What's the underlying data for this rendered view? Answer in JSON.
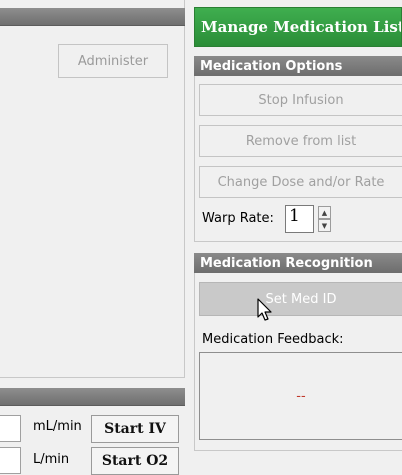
{
  "left": {
    "administer_label": "Administer",
    "iv_unit": "mL/min",
    "iv_button": "Start IV",
    "o2_unit": "L/min",
    "o2_button": "Start O2"
  },
  "manage": {
    "label": "Manage Medication List"
  },
  "medication_options": {
    "header": "Medication Options",
    "stop_infusion": "Stop Infusion",
    "remove_from_list": "Remove from list",
    "change_dose": "Change Dose and/or Rate",
    "warp_rate_label": "Warp Rate:",
    "warp_rate_value": "1"
  },
  "medication_recognition": {
    "header": "Medication Recognition",
    "set_med_id": "Set Med ID",
    "feedback_label": "Medication Feedback:",
    "feedback_value": "--"
  },
  "colors": {
    "manage_green": "#2f9a3e",
    "header_gray": "#7c7c7c",
    "feedback_red": "#c0392b"
  },
  "icons": [
    "spin-up-icon",
    "spin-down-icon",
    "mouse-cursor-icon"
  ]
}
